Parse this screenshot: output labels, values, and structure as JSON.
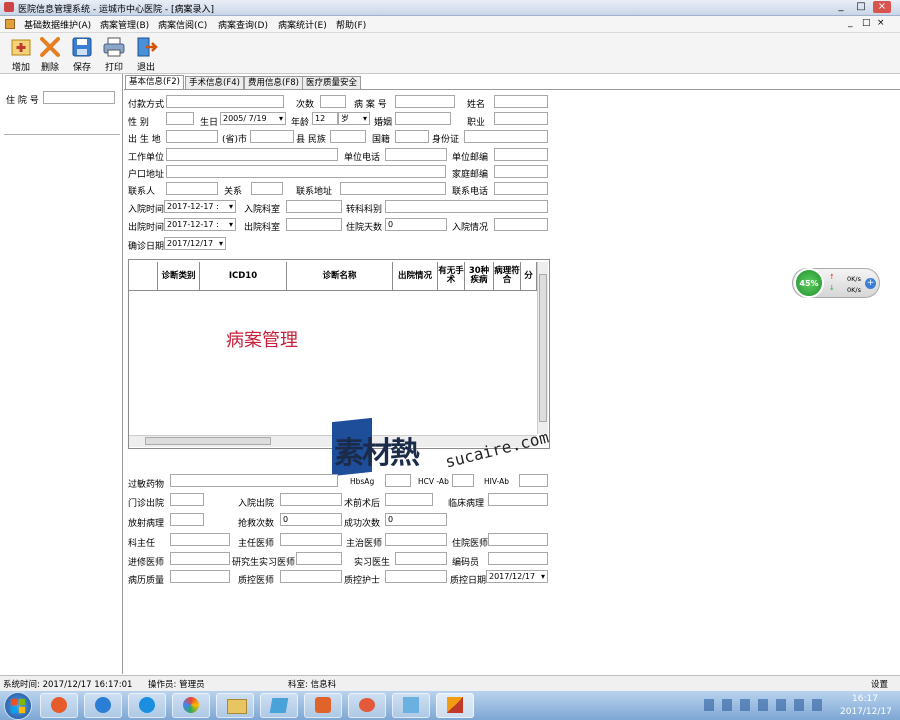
{
  "window": {
    "title": "医院信息管理系统   -   运城市中心医院 - [病案录入]",
    "controls": [
      "_",
      "□",
      "×"
    ],
    "inner_controls": [
      "_",
      "□",
      "×"
    ]
  },
  "menu": [
    "基础数据维护(A)",
    "病案管理(B)",
    "病案信阅(C)",
    "病案查询(D)",
    "病案统计(E)",
    "帮助(F)"
  ],
  "toolbar": [
    {
      "label": "增加",
      "icon": "add-icon"
    },
    {
      "label": "删除",
      "icon": "delete-icon"
    },
    {
      "label": "保存",
      "icon": "save-icon"
    },
    {
      "label": "打印",
      "icon": "print-icon"
    },
    {
      "label": "退出",
      "icon": "exit-icon"
    }
  ],
  "left": {
    "admission_label": "住 院 号",
    "admission_value": ""
  },
  "tabs": [
    "基本信息(F2)",
    "手术信息(F4)",
    "费用信息(F8)",
    "医疗质量安全"
  ],
  "form": {
    "payment": "付款方式",
    "times": "次数",
    "case_no": "病 案 号",
    "name": "姓名",
    "gender": "性  别",
    "birth": "生日",
    "birth_value": "2005/ 7/19",
    "age": "年龄",
    "age_value": "12",
    "age_unit": "岁",
    "marital": "婚姻",
    "occupation": "职业",
    "birthplace": "出 生 地",
    "province": "(省)市",
    "county": "县 民族",
    "nationality": "国籍",
    "idcard": "身份证",
    "workplace": "工作单位",
    "work_phone": "单位电话",
    "work_zip": "单位邮编",
    "household": "户口地址",
    "home_zip": "家庭邮编",
    "contact": "联系人",
    "relation": "关系",
    "contact_addr": "联系地址",
    "contact_phone": "联系电话",
    "admit_time": "入院时间",
    "admit_time_value": "2017-12-17 :",
    "admit_dept": "入院科室",
    "transfer": "转科科别",
    "discharge_time": "出院时间",
    "discharge_time_value": "2017-12-17 :",
    "discharge_dept": "出院科室",
    "stay_days": "住院天数",
    "stay_days_value": "0",
    "admit_condition": "入院情况",
    "confirm_date": "确诊日期",
    "confirm_date_value": "2017/12/17"
  },
  "grid": {
    "headers": [
      "诊断类别",
      "ICD10",
      "诊断名称",
      "出院情况",
      "有无手术",
      "30种疾病",
      "病理符合",
      "分"
    ],
    "watermark": "病案管理"
  },
  "lower": {
    "allergy": "过敏药物",
    "hbsag": "HbsAg",
    "hcv": "HCV -Ab",
    "hiv": "HIV-Ab",
    "op_dis": "门诊出院",
    "in_dis": "入院出院",
    "pre_post": "术前术后",
    "clinic_path": "临床病理",
    "radiology": "放射病理",
    "rescue": "抢救次数",
    "rescue_value": "0",
    "success": "成功次数",
    "success_value": "0",
    "director": "科主任",
    "chief": "主任医师",
    "attending": "主治医师",
    "resident": "住院医师",
    "advanced": "进修医师",
    "graduate": "研究生实习医师",
    "intern": "实习医生",
    "coder": "编码员",
    "quality": "病历质量",
    "qc_doctor": "质控医师",
    "qc_nurse": "质控护士",
    "qc_date": "质控日期",
    "qc_date_value": "2017/12/17"
  },
  "status": {
    "time": "系统时间: 2017/12/17  16:17:01",
    "operator": "操作员: 管理员",
    "dept": "科室: 信息科",
    "settings": "设置"
  },
  "widget": {
    "percent": "45%",
    "up": "0K/s",
    "down": "0K/s"
  },
  "watermark_site": {
    "cn": "素材熱",
    "en": "sucaire.com"
  },
  "taskbar": {
    "time": "16:17",
    "date": "2017/12/17"
  }
}
